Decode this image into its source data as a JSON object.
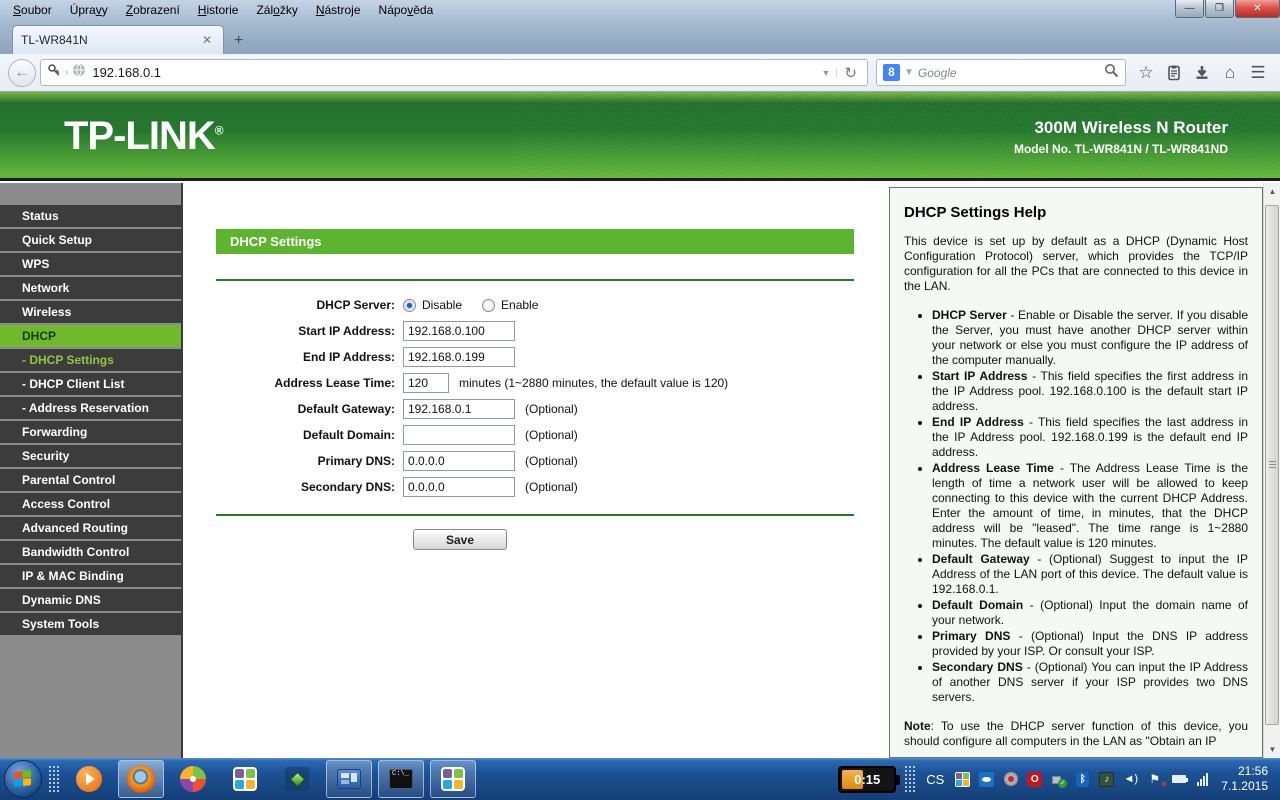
{
  "window": {
    "menus": [
      {
        "label": "Soubor",
        "u": 0
      },
      {
        "label": "Úpravy",
        "u": 4
      },
      {
        "label": "Zobrazení",
        "u": 0
      },
      {
        "label": "Historie",
        "u": 0
      },
      {
        "label": "Záložky",
        "u": 3
      },
      {
        "label": "Nástroje",
        "u": 0
      },
      {
        "label": "Nápověda",
        "u": 4
      }
    ]
  },
  "browser": {
    "tab_title": "TL-WR841N",
    "url": "192.168.0.1",
    "search_placeholder": "Google",
    "search_engine_initial": "8"
  },
  "banner": {
    "logo": "TP-LINK",
    "reg": "®",
    "product": "300M Wireless N Router",
    "model": "Model No. TL-WR841N / TL-WR841ND",
    "accent_green": "#5db52f"
  },
  "sidebar": {
    "items": [
      {
        "label": "Status"
      },
      {
        "label": "Quick Setup"
      },
      {
        "label": "WPS"
      },
      {
        "label": "Network"
      },
      {
        "label": "Wireless"
      },
      {
        "label": "DHCP",
        "active": true
      },
      {
        "label": "- DHCP Settings",
        "sub": true,
        "active": true
      },
      {
        "label": "- DHCP Client List",
        "sub": true
      },
      {
        "label": "- Address Reservation",
        "sub": true
      },
      {
        "label": "Forwarding"
      },
      {
        "label": "Security"
      },
      {
        "label": "Parental Control"
      },
      {
        "label": "Access Control"
      },
      {
        "label": "Advanced Routing"
      },
      {
        "label": "Bandwidth Control"
      },
      {
        "label": "IP & MAC Binding"
      },
      {
        "label": "Dynamic DNS"
      },
      {
        "label": "System Tools"
      }
    ]
  },
  "main": {
    "title": "DHCP Settings",
    "form": {
      "rows": [
        {
          "label": "DHCP Server:",
          "type": "radio",
          "options": [
            {
              "label": "Disable",
              "checked": true
            },
            {
              "label": "Enable",
              "checked": false
            }
          ]
        },
        {
          "label": "Start IP Address:",
          "value": "192.168.0.100"
        },
        {
          "label": "End IP Address:",
          "value": "192.168.0.199"
        },
        {
          "label": "Address Lease Time:",
          "value": "120",
          "note": "minutes (1~2880 minutes, the default value is 120)"
        },
        {
          "label": "Default Gateway:",
          "value": "192.168.0.1",
          "note": "(Optional)"
        },
        {
          "label": "Default Domain:",
          "value": "",
          "note": "(Optional)"
        },
        {
          "label": "Primary DNS:",
          "value": "0.0.0.0",
          "note": "(Optional)"
        },
        {
          "label": "Secondary DNS:",
          "value": "0.0.0.0",
          "note": "(Optional)"
        }
      ],
      "save_label": "Save"
    }
  },
  "help": {
    "title": "DHCP Settings Help",
    "intro": "This device is set up by default as a DHCP (Dynamic Host Configuration Protocol) server, which provides the TCP/IP configuration for all the PCs that are connected to this device in the LAN.",
    "bullets": [
      {
        "term": "DHCP Server",
        "text": " - Enable or Disable the server. If you disable the Server, you must have another DHCP server within your network or else you must configure the IP address of the computer manually."
      },
      {
        "term": "Start IP Address",
        "text": " - This field specifies the first address in the IP Address pool. 192.168.0.100 is the default start IP address."
      },
      {
        "term": "End IP Address",
        "text": " - This field specifies the last address in the IP Address pool. 192.168.0.199 is the default end IP address."
      },
      {
        "term": "Address Lease Time",
        "text": " - The Address Lease Time is the length of time a network user will be allowed to keep connecting to this device with the current DHCP Address. Enter the amount of time, in minutes, that the DHCP address will be \"leased\". The time range is 1~2880 minutes. The default value is 120 minutes."
      },
      {
        "term": "Default Gateway",
        "text": " - (Optional) Suggest to input the IP Address of the LAN port of this device. The default value is 192.168.0.1."
      },
      {
        "term": "Default Domain",
        "text": " - (Optional) Input the domain name of your network."
      },
      {
        "term": "Primary DNS",
        "text": " - (Optional) Input the DNS IP address provided by your ISP. Or consult your ISP."
      },
      {
        "term": "Secondary DNS",
        "text": " - (Optional) You can input the IP Address of another DNS server if your ISP provides two DNS servers."
      }
    ],
    "note_term": "Note",
    "note_text": ": To use the DHCP server function of this device, you should configure all computers in the LAN as \"Obtain an IP"
  },
  "taskbar": {
    "battery_gadget": "0:15",
    "language": "CS",
    "time": "21:56",
    "date": "7.1.2015",
    "cmd_glyph": "C:\\_"
  }
}
